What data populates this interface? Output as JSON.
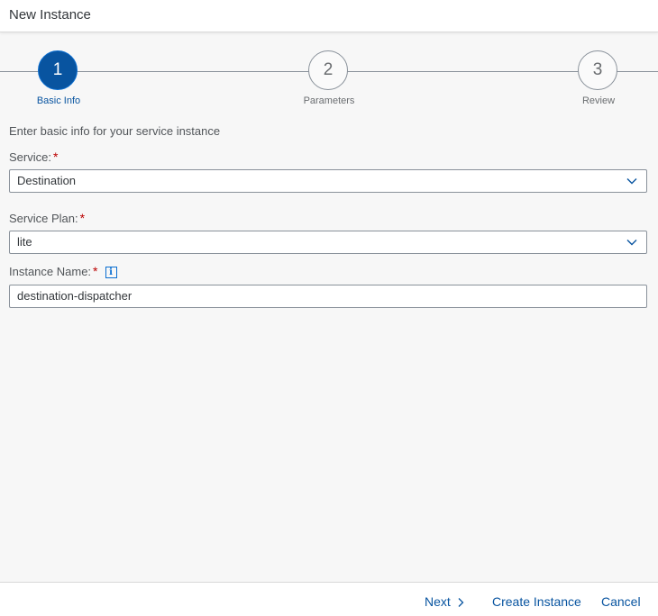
{
  "dialog": {
    "title": "New Instance"
  },
  "wizard": {
    "steps": [
      {
        "number": "1",
        "label": "Basic Info",
        "state": "active"
      },
      {
        "number": "2",
        "label": "Parameters",
        "state": "inactive"
      },
      {
        "number": "3",
        "label": "Review",
        "state": "inactive"
      }
    ]
  },
  "form": {
    "intro": "Enter basic info for your service instance",
    "required_marker": "*",
    "service": {
      "label": "Service:",
      "value": "Destination"
    },
    "service_plan": {
      "label": "Service Plan:",
      "value": "lite"
    },
    "instance_name": {
      "label": "Instance Name:",
      "value": "destination-dispatcher",
      "info_icon": "i"
    }
  },
  "footer": {
    "next_label": "Next",
    "create_label": "Create Instance",
    "cancel_label": "Cancel"
  },
  "colors": {
    "accent": "#0854a0",
    "required": "#bb0000",
    "background": "#f7f7f7"
  },
  "icons": {
    "dropdown": "chevron-down-icon",
    "next": "chevron-right-icon",
    "info": "info-icon"
  }
}
